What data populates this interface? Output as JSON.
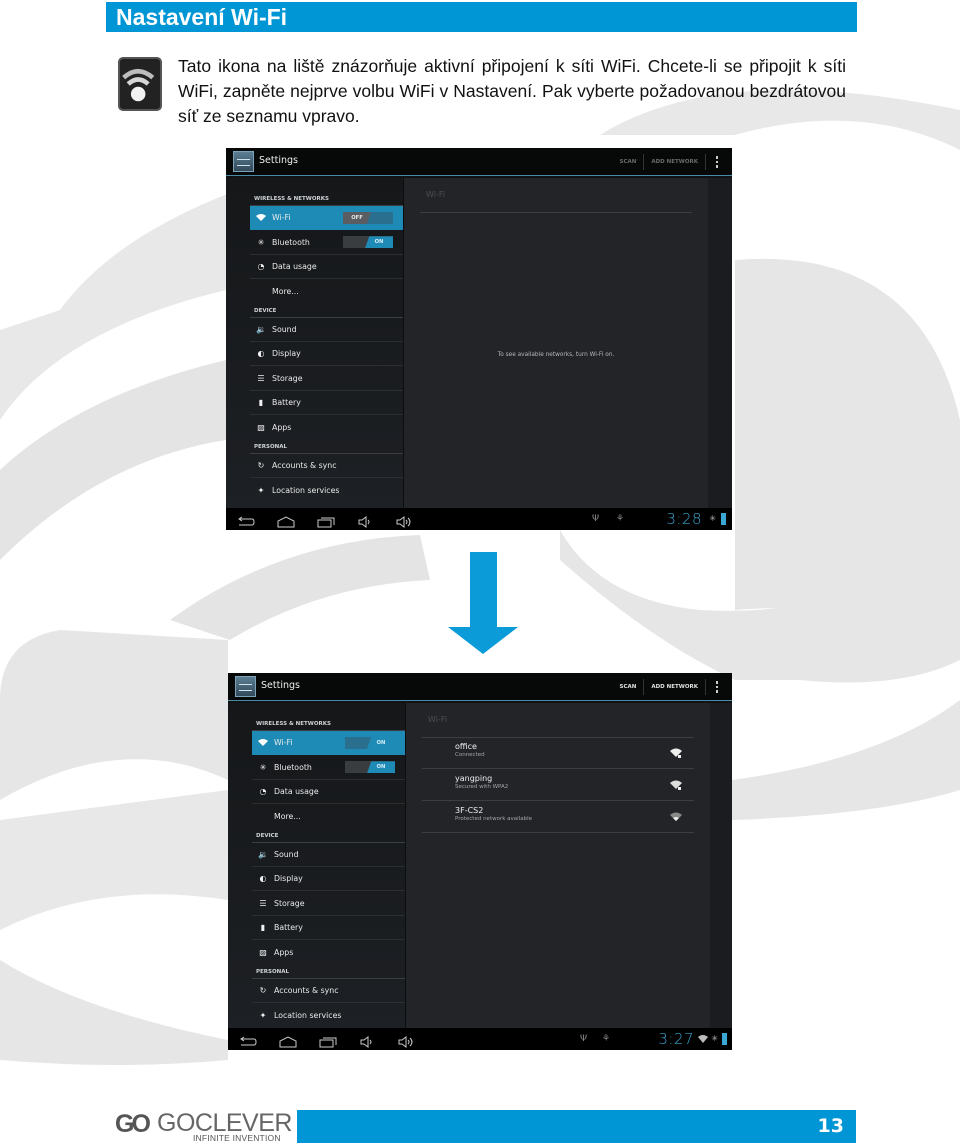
{
  "header": {
    "title": "Nastavení Wi-Fi"
  },
  "intro": {
    "icon": "wifi-status-icon",
    "text": "Tato ikona na liště znázorňuje aktivní připojení k síti WiFi. Chcete-li se připojit k síti WiFi, zapněte nejprve volbu WiFi v Nastavení. Pak vyberte požadovanou bezdrátovou síť ze seznamu vpravo."
  },
  "screens": [
    {
      "app_title": "Settings",
      "actions": {
        "scan": "SCAN",
        "add_network": "ADD NETWORK",
        "overflow_icon": "overflow-menu-icon"
      },
      "sections": {
        "wireless": "WIRELESS & NETWORKS",
        "device": "DEVICE",
        "personal": "PERSONAL"
      },
      "menu": {
        "wifi": {
          "label": "Wi-Fi",
          "icon": "wifi-icon",
          "toggle": "OFF",
          "active": true
        },
        "bluetooth": {
          "label": "Bluetooth",
          "icon": "bluetooth-icon",
          "toggle": "ON"
        },
        "data_usage": {
          "label": "Data usage",
          "icon": "data-usage-icon"
        },
        "more": {
          "label": "More..."
        },
        "sound": {
          "label": "Sound",
          "icon": "sound-icon"
        },
        "display": {
          "label": "Display",
          "icon": "display-icon"
        },
        "storage": {
          "label": "Storage",
          "icon": "storage-icon"
        },
        "battery": {
          "label": "Battery",
          "icon": "battery-icon"
        },
        "apps": {
          "label": "Apps",
          "icon": "apps-icon"
        },
        "accounts": {
          "label": "Accounts & sync",
          "icon": "sync-icon"
        },
        "location": {
          "label": "Location services",
          "icon": "location-icon"
        }
      },
      "detail": {
        "title": "Wi-Fi",
        "empty_message": "To see available networks, turn Wi-Fi on."
      },
      "status_bar": {
        "time": "3:28"
      }
    },
    {
      "app_title": "Settings",
      "actions": {
        "scan": "SCAN",
        "add_network": "ADD NETWORK",
        "overflow_icon": "overflow-menu-icon"
      },
      "sections": {
        "wireless": "WIRELESS & NETWORKS",
        "device": "DEVICE",
        "personal": "PERSONAL"
      },
      "menu": {
        "wifi": {
          "label": "Wi-Fi",
          "icon": "wifi-icon",
          "toggle": "ON",
          "active": true
        },
        "bluetooth": {
          "label": "Bluetooth",
          "icon": "bluetooth-icon",
          "toggle": "ON"
        },
        "data_usage": {
          "label": "Data usage",
          "icon": "data-usage-icon"
        },
        "more": {
          "label": "More..."
        },
        "sound": {
          "label": "Sound",
          "icon": "sound-icon"
        },
        "display": {
          "label": "Display",
          "icon": "display-icon"
        },
        "storage": {
          "label": "Storage",
          "icon": "storage-icon"
        },
        "battery": {
          "label": "Battery",
          "icon": "battery-icon"
        },
        "apps": {
          "label": "Apps",
          "icon": "apps-icon"
        },
        "accounts": {
          "label": "Accounts & sync",
          "icon": "sync-icon"
        },
        "location": {
          "label": "Location services",
          "icon": "location-icon"
        }
      },
      "detail": {
        "title": "Wi-Fi",
        "networks": [
          {
            "name": "office",
            "status": "Connected",
            "secured": true
          },
          {
            "name": "yangping",
            "status": "Secured with WPA2",
            "secured": true
          },
          {
            "name": "3F-CS2",
            "status": "Protected network available",
            "secured": false
          }
        ]
      },
      "status_bar": {
        "time": "3:27"
      }
    }
  ],
  "footer": {
    "logo_mark": "GO",
    "logo_word": "GOCLEVER",
    "logo_tagline": "INFINITE INVENTION",
    "page_number": "13"
  },
  "colors": {
    "brand_blue": "#0096d6",
    "android_accent": "#1e8ab6",
    "clock": "#3aa7d4"
  }
}
